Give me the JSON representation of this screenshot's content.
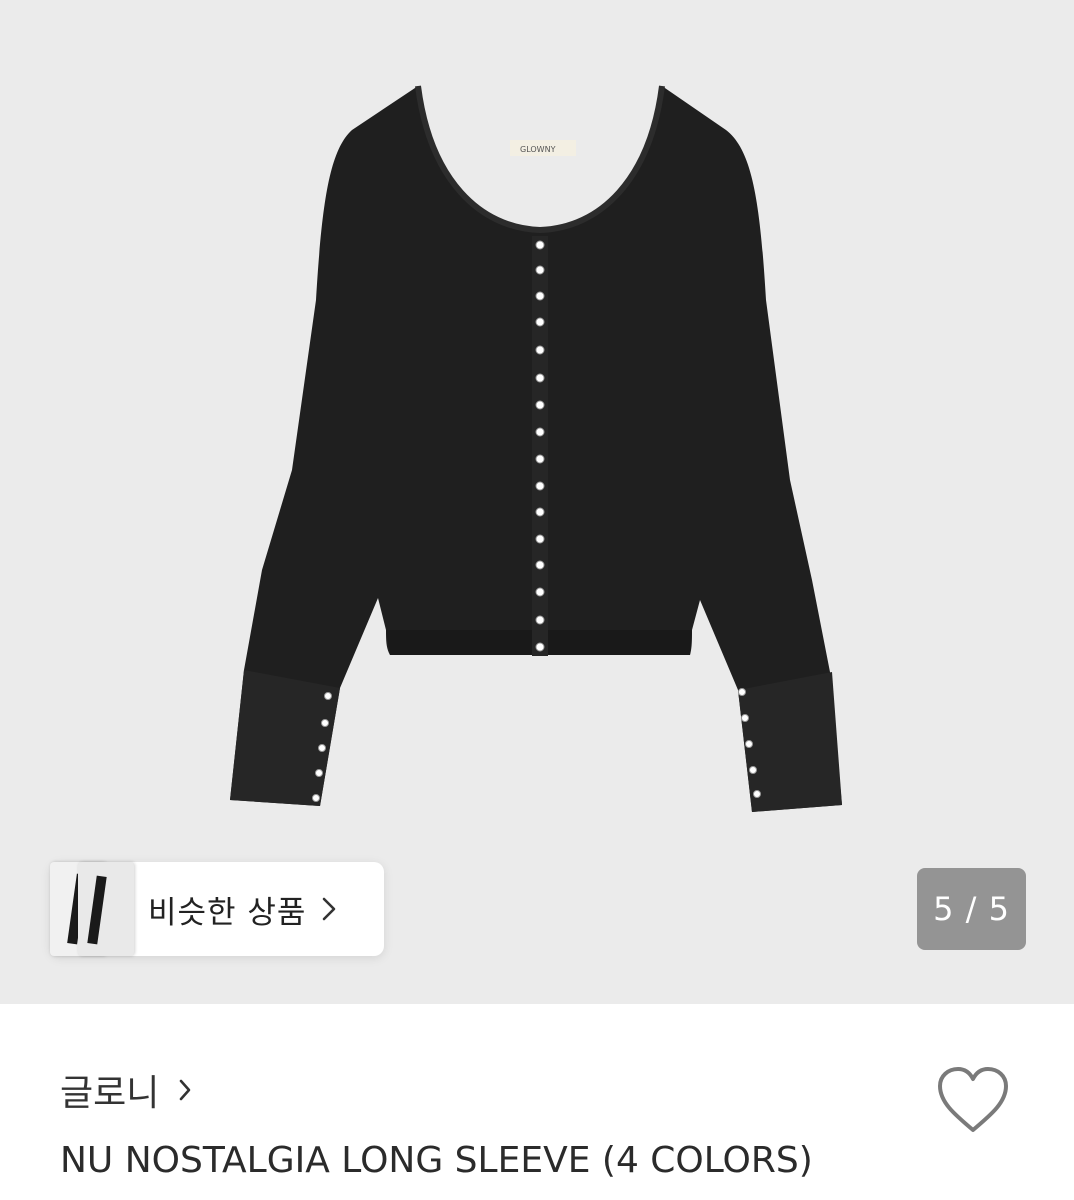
{
  "gallery": {
    "product_image_alt": "black square-neck snap-front long sleeve top",
    "current_page": "5 / 5",
    "shirt_label_text": "GLOWNY"
  },
  "similar_products": {
    "label": "비슷한 상품",
    "arrow_icon": "chevron-right-icon"
  },
  "product_info": {
    "brand": "글로니",
    "brand_arrow_icon": "chevron-right-icon",
    "title": "NU NOSTALGIA LONG SLEEVE (4 COLORS)",
    "wishlist_icon": "heart-outline-icon"
  },
  "colors": {
    "gallery_bg": "#ebebeb",
    "garment": "#1e1e1e",
    "counter_bg": "#808080"
  }
}
